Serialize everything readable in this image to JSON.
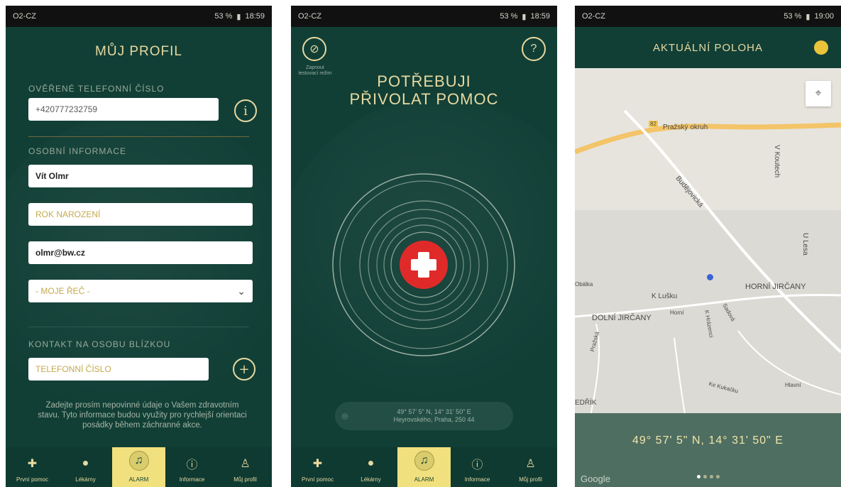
{
  "status_bars": [
    {
      "carrier": "O2-CZ",
      "right": "53 %",
      "time": "18:59"
    },
    {
      "carrier": "O2-CZ",
      "right": "53 %",
      "time": "18:59"
    },
    {
      "carrier": "O2-CZ",
      "right": "53 %",
      "time": "19:00"
    }
  ],
  "profile": {
    "title": "MŮJ PROFIL",
    "verified_phone_label": "OVĚŘENÉ TELEFONNÍ ČÍSLO",
    "phone_value": "+420777232759",
    "personal_info_label": "OSOBNÍ INFORMACE",
    "name_value": "Vít Olmr",
    "birth_year_placeholder": "ROK NAROZENÍ",
    "email_value": "olmr@bw.cz",
    "language_select": "- MOJE ŘEČ -",
    "close_contact_label": "KONTAKT NA OSOBU BLÍZKOU",
    "contact_phone_placeholder": "TELEFONNÍ ČÍSLO",
    "notice": "Zadejte prosím nepovinné údaje o Vašem zdravotním stavu. Tyto informace budou využity pro rychlejší orientaci posádky během záchranné akce."
  },
  "alarm": {
    "practice_label": "Zapnout testovací režim",
    "hero_line1": "POTŘEBUJI",
    "hero_line2": "PŘIVOLAT POMOC",
    "help_icon": "?",
    "coords_line1": "49° 57' 5\" N, 14° 31' 50\" E",
    "coords_line2": "Heyrovského, Praha, 250 44"
  },
  "location": {
    "title": "AKTUÁLNÍ POLOHA",
    "coords": "49° 57' 5\" N, 14° 31' 50\" E",
    "attribution": "Google",
    "map_labels": {
      "route_number": "82",
      "ring": "Pražský okruh",
      "budejovicka": "Budějovická",
      "v_kouttech": "V Koutech",
      "horni": "HORNÍ JIRČANY",
      "dolni": "DOLNÍ JIRČANY",
      "k_lusku": "K Lušku",
      "horni_small": "Horní",
      "k_hrazenci": "K Hrázenci",
      "sadova": "Sadová",
      "prazska": "Pražská",
      "ke_kukacku": "Ke Kukačku",
      "hlavni": "Hlavní",
      "u_lesa": "U Lesa",
      "dobrik": "EDŘÍK",
      "obalka": "Obálka"
    }
  },
  "nav": [
    "První pomoc",
    "Lékárny",
    "ALARM",
    "Informace",
    "Můj profil"
  ],
  "colors": {
    "brand": "#113f36",
    "accent": "#e8d9a0",
    "active_tab": "#f1e07e",
    "alarm_red": "#e02a2a"
  }
}
